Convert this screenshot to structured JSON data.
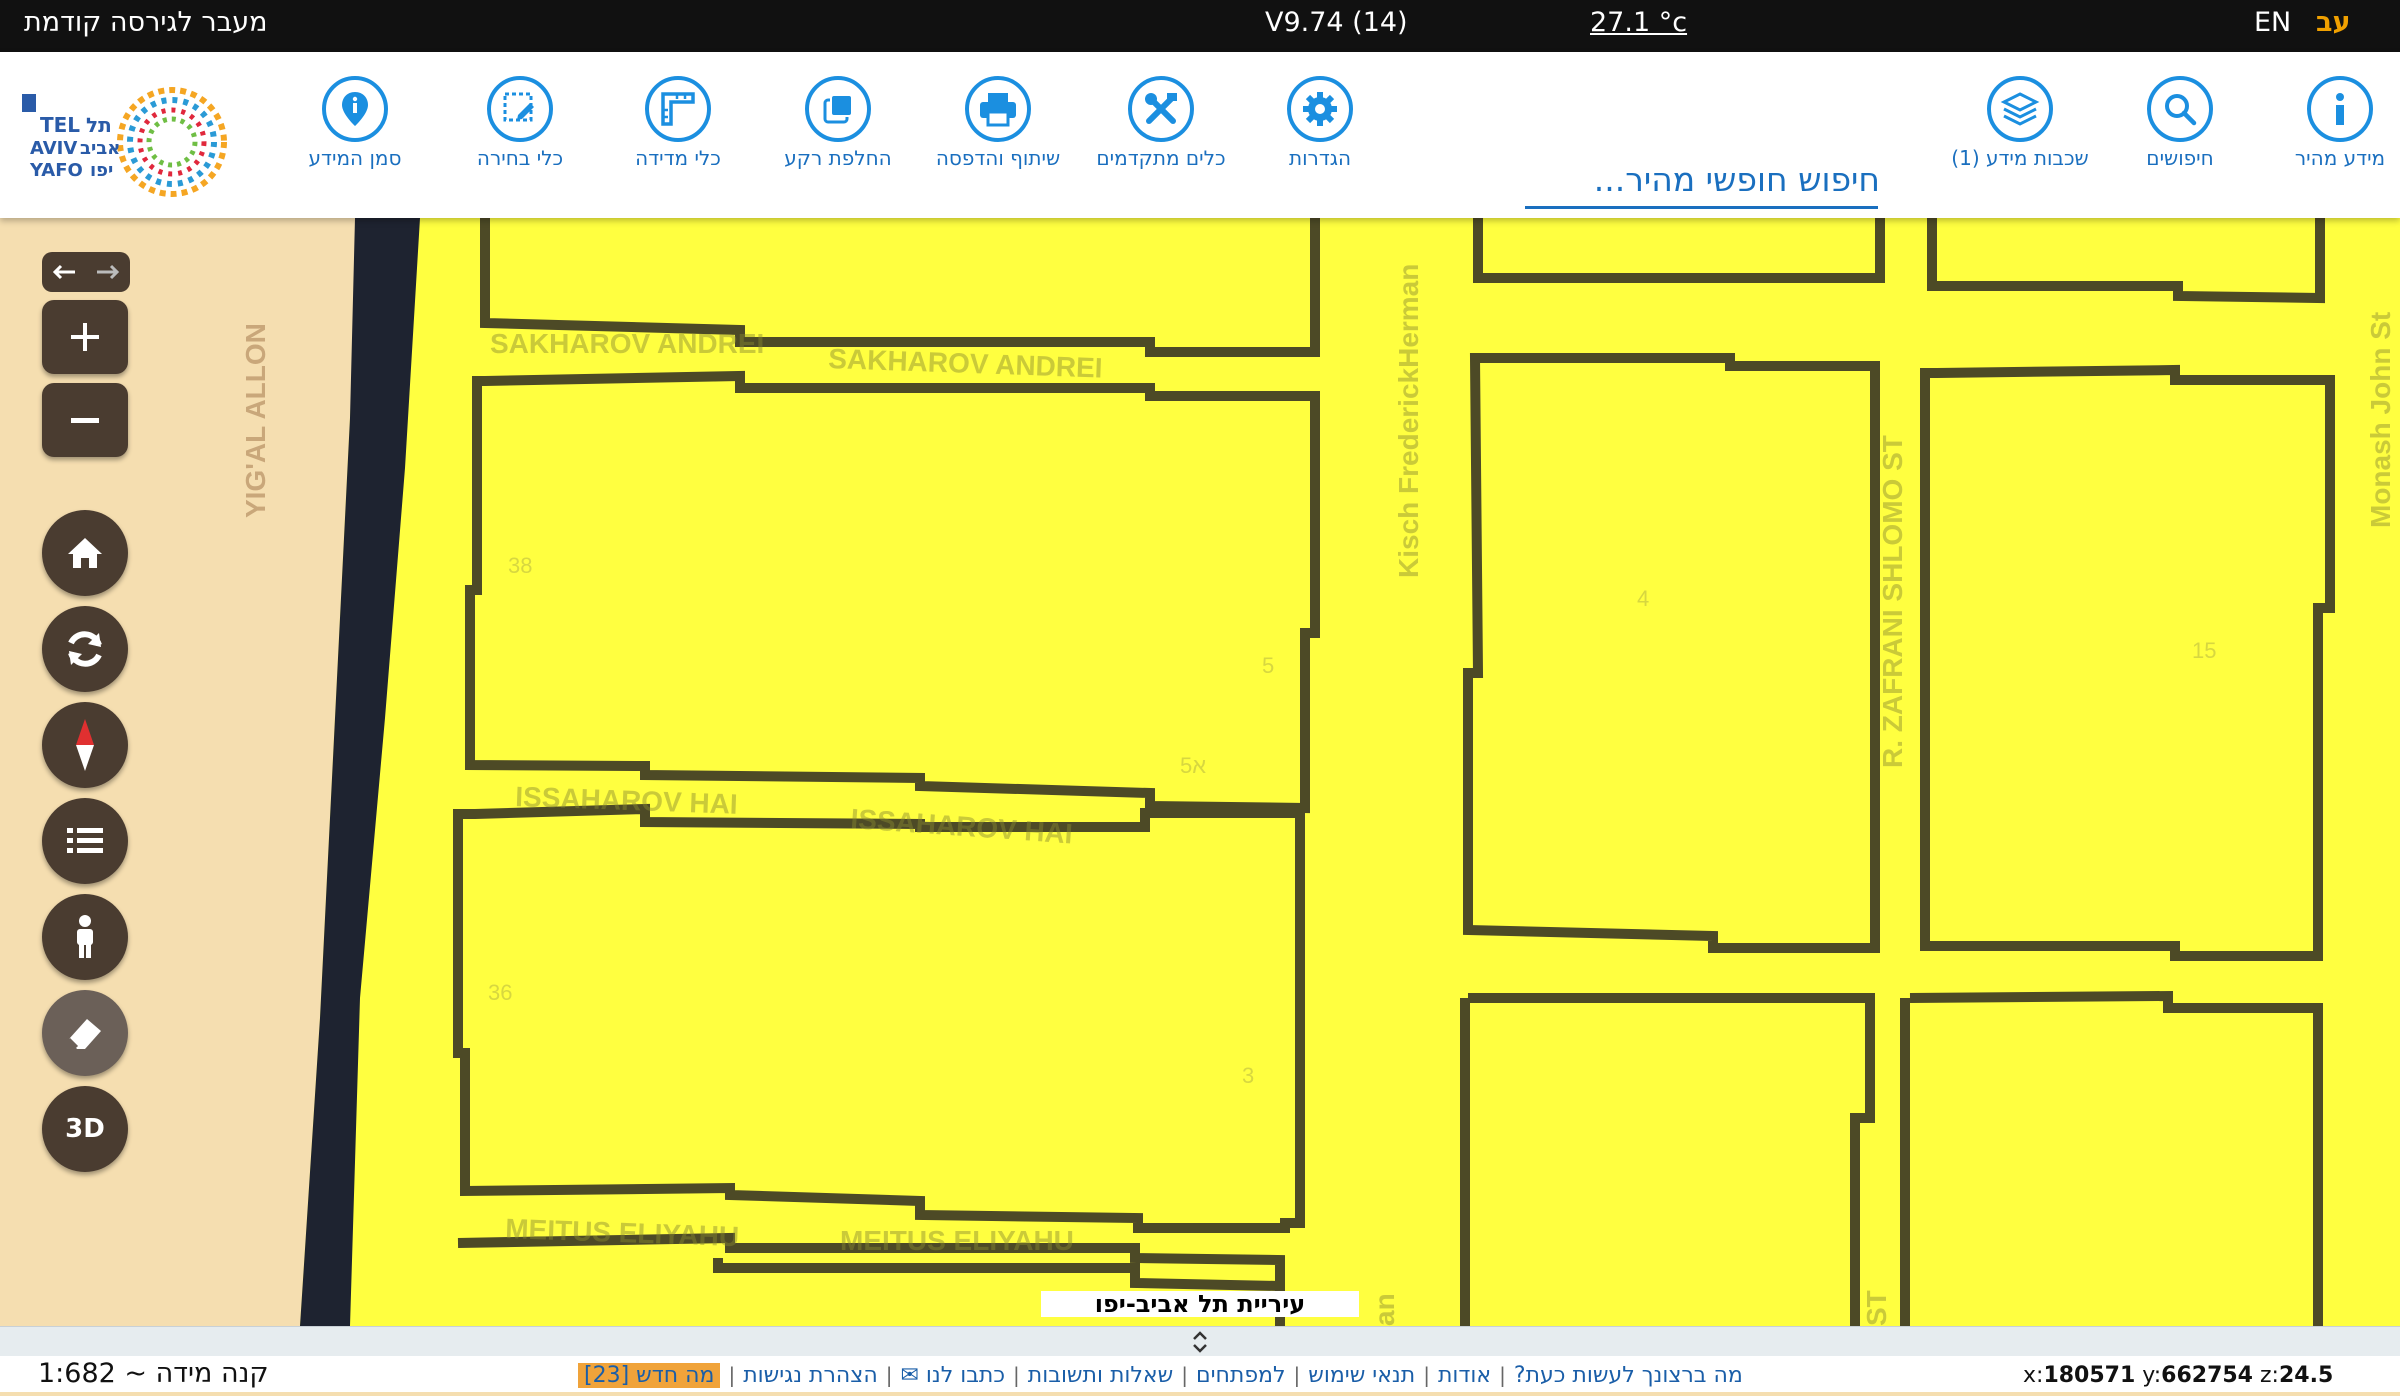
{
  "topbar": {
    "prev_version_link": "מעבר לגירסה קודמת",
    "version": "V9.74 (14)",
    "temperature": "27.1 °c",
    "lang_en": "EN",
    "lang_he": "עב"
  },
  "toolbar": {
    "logo_text": [
      "תל",
      "אביב",
      "יפו",
      "TEL",
      "AVIV",
      "YAFO"
    ],
    "search_placeholder": "חיפוש חופשי מהיר...",
    "tools": [
      {
        "label": "סמן המידע",
        "icon": "map-marker-info-icon"
      },
      {
        "label": "כלי בחירה",
        "icon": "selection-edit-icon"
      },
      {
        "label": "כלי מדידה",
        "icon": "ruler-icon"
      },
      {
        "label": "החלפת רקע",
        "icon": "switch-background-icon"
      },
      {
        "label": "שיתוף והדפסה",
        "icon": "printer-icon"
      },
      {
        "label": "כלים מתקדמים",
        "icon": "tools-icon"
      },
      {
        "label": "הגדרות",
        "icon": "gear-icon"
      },
      {
        "label": "שכבות מידע (1)",
        "icon": "layers-icon"
      },
      {
        "label": "חיפושים",
        "icon": "search-icon"
      },
      {
        "label": "מידע מהיר",
        "icon": "info-icon"
      }
    ]
  },
  "map": {
    "street_labels": [
      "YIG'AL ALLON",
      "SAKHAROV ANDREI",
      "SAKHAROV ANDREI",
      "ISSAHAROV HAI",
      "ISSAHAROV HAI",
      "MEITUS ELIYAHU",
      "MEITUS ELIYAHU",
      "Kisch FrederickHerman",
      "R. ZAFRANI SHLOMO ST",
      "Monash John St",
      "ST",
      "an"
    ],
    "parcel_numbers": [
      "38",
      "36",
      "5",
      "3",
      "5א",
      "4",
      "15"
    ],
    "city_label": "עיריית תל אביב-יפו"
  },
  "controls": {
    "zoom_in": "+",
    "zoom_out": "−",
    "three_d": "3D"
  },
  "footer": {
    "scale": "1:682 ~ קנה מידה",
    "links": [
      "מה ברצונך לעשות כעת?",
      "אודות",
      "תנאי שימוש",
      "למפתחים",
      "שאלות ותשובות",
      "כתבו לנו ✉",
      "הצהרת נגישות"
    ],
    "whats_new": "מה חדש [23]",
    "coord_x_label": "x:",
    "coord_x": "180571",
    "coord_y_label": "y:",
    "coord_y": "662754",
    "coord_z_label": "z:",
    "coord_z": "24.5"
  },
  "colors": {
    "map_yellow": "#ffff40",
    "parcel_outline": "#4d4a26",
    "sand": "#f5deb0",
    "toolbar_blue": "#1b8fe0",
    "control_brown": "#4a3c30",
    "highlight_orange": "#f0a000"
  }
}
